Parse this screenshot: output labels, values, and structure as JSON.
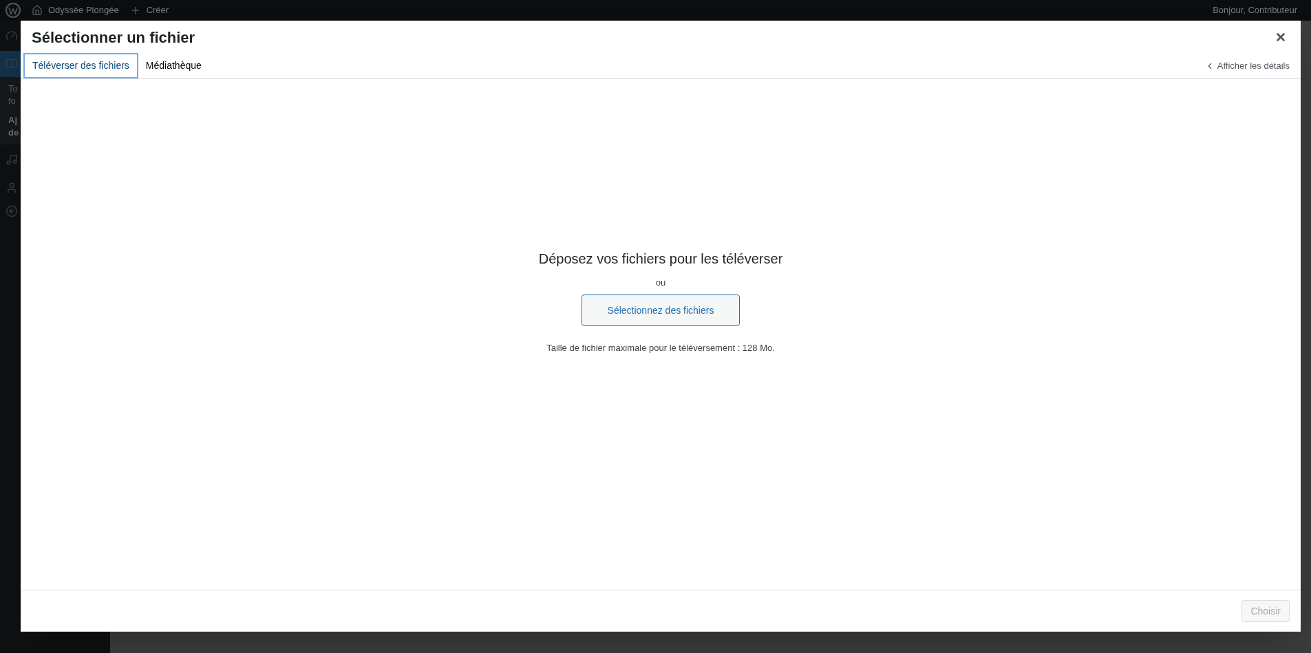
{
  "admin_bar": {
    "site_name": "Odyssée Plongée",
    "new_label": "Créer",
    "greeting": "Bonjour, Contributeur"
  },
  "sidebar": {
    "submenu": [
      {
        "lines": [
          "To",
          "fo"
        ],
        "selected": false
      },
      {
        "lines": [
          "Aj",
          "de"
        ],
        "selected": true
      }
    ]
  },
  "modal": {
    "title": "Sélectionner un fichier",
    "tabs": [
      {
        "label": "Téléverser des fichiers",
        "selected": true
      },
      {
        "label": "Médiathèque",
        "selected": false
      }
    ],
    "details_toggle": "Afficher les détails",
    "uploader": {
      "heading": "Déposez vos fichiers pour les téléverser",
      "or": "ou",
      "button": "Sélectionnez des fichiers",
      "max_size": "Taille de fichier maximale pour le téléversement : 128 Mo."
    },
    "footer": {
      "button": {
        "label": "Choisir",
        "disabled": true
      }
    }
  }
}
